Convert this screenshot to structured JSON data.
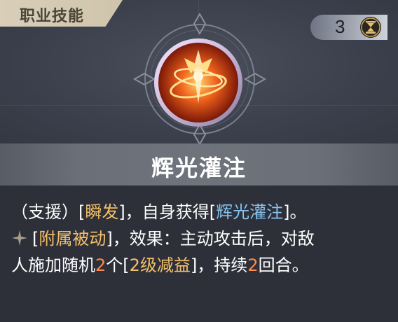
{
  "header": {
    "tag_label": "职业技能"
  },
  "cost": {
    "value": "3",
    "icon": "hourglass-icon"
  },
  "skill": {
    "name": "辉光灌注",
    "icon": "radiant-flame-emblem"
  },
  "description": {
    "line1": {
      "p1": "（支援）[",
      "kw1": "瞬发",
      "p2": "]，自身获得[",
      "kw2": "辉光灌注",
      "p3": "]。"
    },
    "line2": {
      "icon": "sparkle-icon",
      "p1": "[",
      "kw1": "附属被动",
      "p2": "]，效果：主动攻击后，对敌"
    },
    "line3": {
      "p1": "人施加随机",
      "num1": "2",
      "p2": "个[",
      "kw1": "2级减益",
      "p3": "]，持续",
      "num2": "2",
      "p4": "回合。"
    }
  },
  "colors": {
    "keyword_gold": "#f4c06a",
    "keyword_blue": "#86c2ee",
    "number_orange": "#ff8a4a",
    "header_tag_bg": "#d9cfb9"
  }
}
